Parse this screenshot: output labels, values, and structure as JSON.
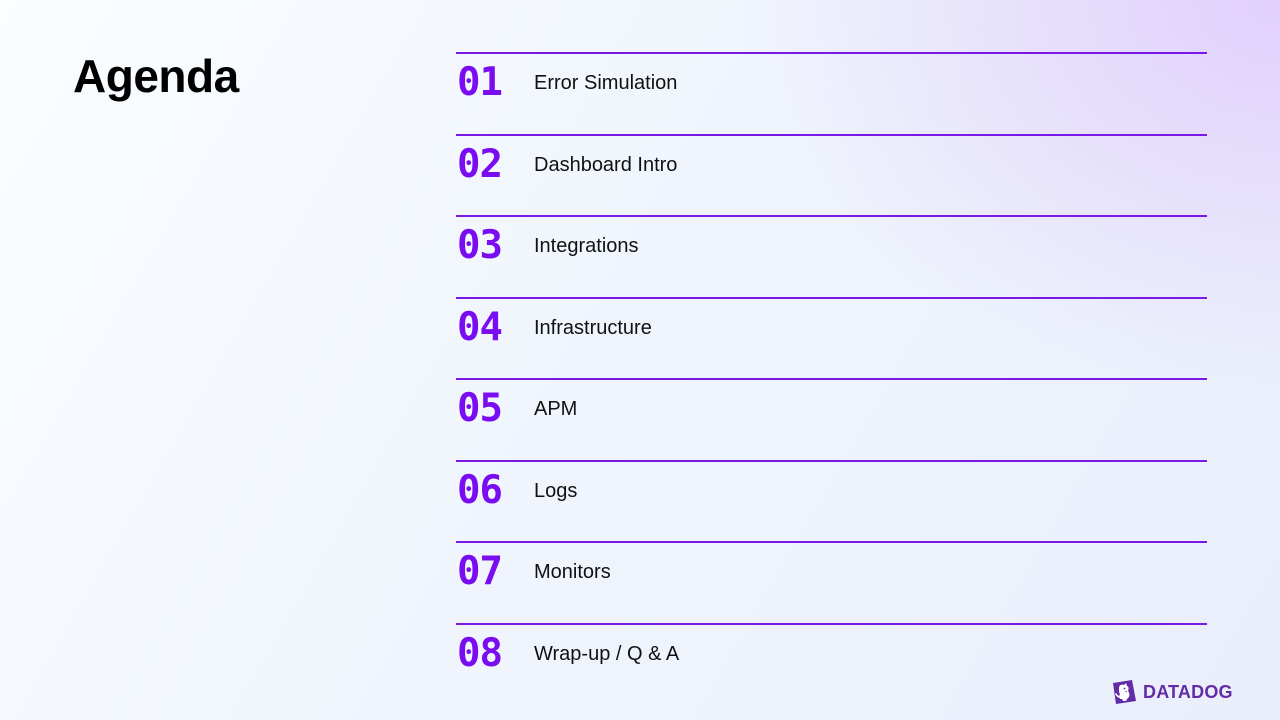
{
  "slide": {
    "title": "Agenda"
  },
  "agenda": {
    "items": [
      {
        "number": "01",
        "label": "Error Simulation"
      },
      {
        "number": "02",
        "label": "Dashboard Intro"
      },
      {
        "number": "03",
        "label": "Integrations"
      },
      {
        "number": "04",
        "label": "Infrastructure"
      },
      {
        "number": "05",
        "label": "APM"
      },
      {
        "number": "06",
        "label": "Logs"
      },
      {
        "number": "07",
        "label": "Monitors"
      },
      {
        "number": "08",
        "label": "Wrap-up / Q & A"
      }
    ]
  },
  "brand": {
    "name": "DATADOG",
    "icon": "datadog-dog-logo-icon",
    "color": "#632CA6"
  },
  "colors": {
    "accent": "#7A0CF2",
    "divider": "#7A18E6",
    "text": "#111111",
    "background_start": "#FBFDFF",
    "background_end": "#E0CEFC"
  }
}
